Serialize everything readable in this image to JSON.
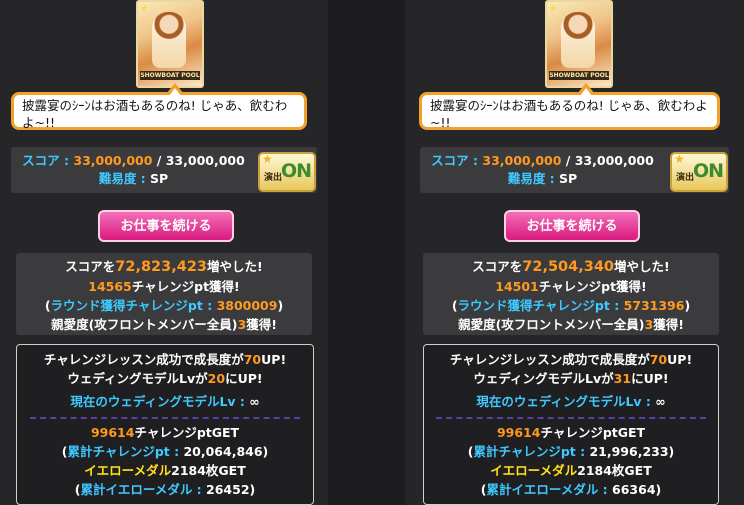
{
  "panels": [
    {
      "card_caption": "SHOWBOAT POOL",
      "dialogue": "披露宴のｼｰﾝはお酒もあるのね! じゃあ、飲むわよ~!!",
      "score_label": "スコア : ",
      "score_value": "33,000,000",
      "score_sep": " / ",
      "score_max": "33,000,000",
      "difficulty_label": "難易度 : ",
      "difficulty_value": "SP",
      "on_button_text": "ON",
      "on_button_sub": "演出",
      "continue_label": "お仕事を続ける",
      "score_inc_prefix": "スコアを",
      "score_inc_value": "72,823,423",
      "score_inc_suffix": "増やした!",
      "challenge_pt": "14565",
      "challenge_pt_suffix": "チャレンジpt獲得!",
      "round_prefix": "(",
      "round_label": "ラウンド獲得チャレンジpt : ",
      "round_value": "3800009",
      "round_suffix": ")",
      "affection_prefix": "親愛度(攻フロントメンバー全員)",
      "affection_value": "3",
      "affection_suffix": "獲得!",
      "lesson_prefix": "チャレンジレッスン成功で成長度が",
      "lesson_value": "70",
      "lesson_suffix": "UP!",
      "wedding_prefix": "ウェディングモデルLvが",
      "wedding_value": "20",
      "wedding_suffix": "にUP!",
      "current_label": "現在のウェディングモデルLv : ",
      "current_value": "∞",
      "get_pt": "99614",
      "get_pt_suffix": "チャレンジptGET",
      "total_label": "累計チャレンジpt : ",
      "total_value": "20,064,846",
      "medal_label": "イエローメダル",
      "medal_value": "2184",
      "medal_suffix": "枚GET",
      "total_medal_label": "累計イエローメダル : ",
      "total_medal_value": "26452"
    },
    {
      "card_caption": "SHOWBOAT POOL",
      "dialogue": "披露宴のｼｰﾝはお酒もあるのね! じゃあ、飲むわよ~!!",
      "score_label": "スコア : ",
      "score_value": "33,000,000",
      "score_sep": " / ",
      "score_max": "33,000,000",
      "difficulty_label": "難易度 : ",
      "difficulty_value": "SP",
      "on_button_text": "ON",
      "on_button_sub": "演出",
      "continue_label": "お仕事を続ける",
      "score_inc_prefix": "スコアを",
      "score_inc_value": "72,504,340",
      "score_inc_suffix": "増やした!",
      "challenge_pt": "14501",
      "challenge_pt_suffix": "チャレンジpt獲得!",
      "round_prefix": "(",
      "round_label": "ラウンド獲得チャレンジpt : ",
      "round_value": "5731396",
      "round_suffix": ")",
      "affection_prefix": "親愛度(攻フロントメンバー全員)",
      "affection_value": "3",
      "affection_suffix": "獲得!",
      "lesson_prefix": "チャレンジレッスン成功で成長度が",
      "lesson_value": "70",
      "lesson_suffix": "UP!",
      "wedding_prefix": "ウェディングモデルLvが",
      "wedding_value": "31",
      "wedding_suffix": "にUP!",
      "current_label": "現在のウェディングモデルLv : ",
      "current_value": "∞",
      "get_pt": "99614",
      "get_pt_suffix": "チャレンジptGET",
      "total_label": "累計チャレンジpt : ",
      "total_value": "21,996,233",
      "medal_label": "イエローメダル",
      "medal_value": "2184",
      "medal_suffix": "枚GET",
      "total_medal_label": "累計イエローメダル : ",
      "total_medal_value": "66364"
    }
  ],
  "colors": {
    "accent_cyan": "#3ec9ff",
    "accent_orange": "#ff9a1f",
    "accent_yellow": "#ffe11a",
    "button_pink": "#d91a80",
    "bubble_border": "#f2a22a"
  }
}
